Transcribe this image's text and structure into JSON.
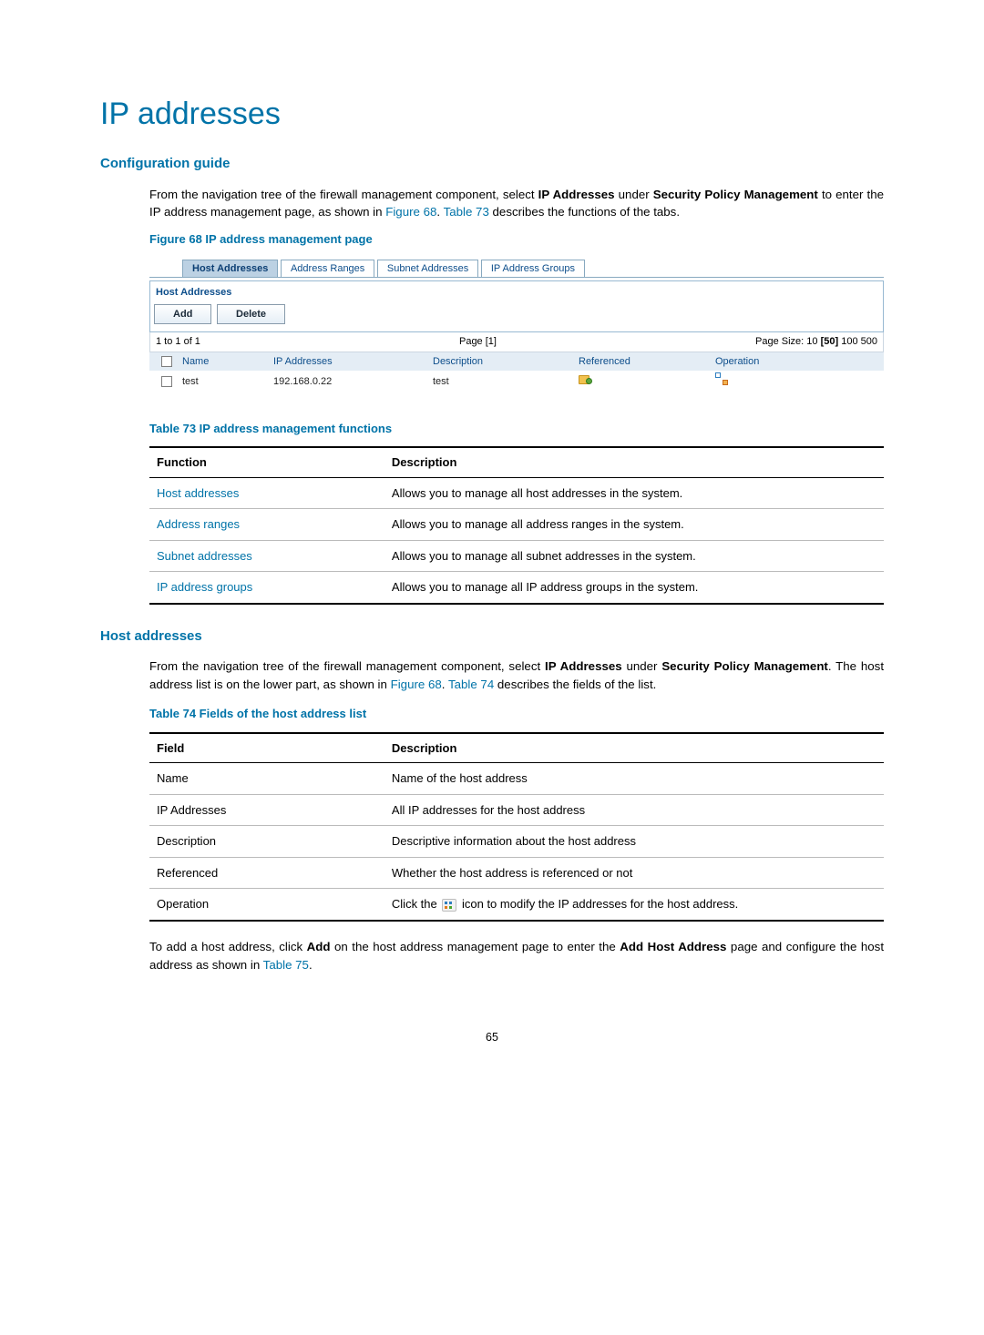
{
  "page_number": "65",
  "title": "IP addresses",
  "section_config_guide": {
    "heading": "Configuration guide",
    "text_pre": "From the navigation tree of the firewall management component, select ",
    "text_ip": "IP Addresses",
    "text_mid1": " under ",
    "text_security": "Security Policy Management",
    "text_mid2": " to enter the IP address management page, as shown in ",
    "link_figure68": "Figure 68",
    "text_period": ". ",
    "link_table73": "Table 73",
    "text_end": " describes the functions of the tabs."
  },
  "figure68_caption": "Figure 68 IP address management page",
  "screenshot": {
    "tabs": [
      "Host Addresses",
      "Address Ranges",
      "Subnet Addresses",
      "IP Address Groups"
    ],
    "active_tab_index": 0,
    "section_label": "Host Addresses",
    "buttons": [
      "Add",
      "Delete"
    ],
    "pager": {
      "left": "1 to 1 of 1",
      "center": "Page [1]",
      "right_label": "Page Size:",
      "sizes": [
        "10",
        "[50]",
        "100",
        "500"
      ]
    },
    "columns": [
      "Name",
      "IP Addresses",
      "Description",
      "Referenced",
      "Operation"
    ],
    "row": {
      "name": "test",
      "ip": "192.168.0.22",
      "desc": "test"
    }
  },
  "table73": {
    "caption": "Table 73 IP address management functions",
    "headers": [
      "Function",
      "Description"
    ],
    "rows": [
      {
        "func": "Host addresses",
        "desc": "Allows you to manage all host addresses in the system."
      },
      {
        "func": "Address ranges",
        "desc": "Allows you to manage all address ranges in the system."
      },
      {
        "func": "Subnet addresses",
        "desc": "Allows you to manage all subnet addresses in the system."
      },
      {
        "func": "IP address groups",
        "desc": "Allows you to manage all IP address groups in the system."
      }
    ]
  },
  "section_host_addr": {
    "heading": "Host addresses",
    "text_pre": "From the navigation tree of the firewall management component, select ",
    "text_ip": "IP Addresses",
    "text_mid1": " under ",
    "text_security": "Security Policy Management",
    "text_mid2": ". The host address list is on the lower part, as shown in ",
    "link_figure68": "Figure 68",
    "text_period": ".  ",
    "link_table74": "Table 74",
    "text_end": " describes the fields of the list."
  },
  "table74": {
    "caption": "Table 74 Fields of the host address list",
    "headers": [
      "Field",
      "Description"
    ],
    "rows": [
      {
        "field": "Name",
        "desc": "Name of the host address"
      },
      {
        "field": "IP Addresses",
        "desc": "All IP addresses for the host address"
      },
      {
        "field": "Description",
        "desc": "Descriptive information about the host address"
      },
      {
        "field": "Referenced",
        "desc": "Whether the host address is referenced or not"
      }
    ],
    "op_row": {
      "field": "Operation",
      "pre": "Click the ",
      "post": " icon to modify the IP addresses for the host address."
    }
  },
  "trailing_para": {
    "text_pre": "To add a host address, click ",
    "text_add": "Add",
    "text_mid1": " on the host address management page to enter the ",
    "text_add_host": "Add Host Address",
    "text_mid2": " page and configure the host address as shown in ",
    "link_table75": "Table 75",
    "text_end": "."
  }
}
